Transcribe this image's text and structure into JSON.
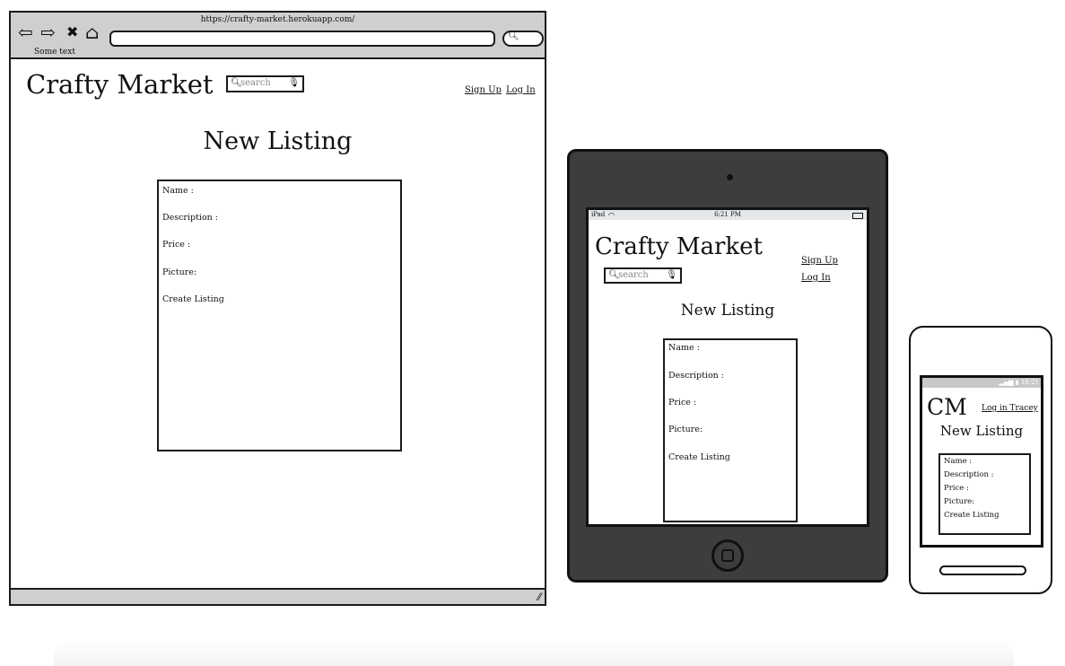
{
  "browser": {
    "url": "https://crafty-market.herokuapp.com/",
    "tab_label": "Some text",
    "nav": {
      "back_icon": "⇦",
      "forward_icon": "⇨",
      "close_icon": "✖",
      "home_icon": "⌂",
      "search_icon": "🔍"
    }
  },
  "site": {
    "title": "Crafty Market",
    "short_title": "CM",
    "search_placeholder": "search",
    "signup_label": "Sign Up",
    "login_label": "Log In",
    "phone_login_label": "Log in Tracey"
  },
  "form": {
    "heading": "New Listing",
    "name_label": "Name :",
    "description_label": "Description :",
    "price_label": "Price :",
    "picture_label": "Picture:",
    "create_button": "Create Listing"
  },
  "tablet_status": {
    "device": "iPad",
    "time": "6:21 PM"
  },
  "phone_status": {
    "time": "18:21"
  },
  "icons": {
    "search": "search-icon",
    "mic": "microphone-icon",
    "wifi": "wifi-icon",
    "battery": "battery-icon",
    "signal": "signal-icon",
    "resize": "resize-grip-icon"
  }
}
